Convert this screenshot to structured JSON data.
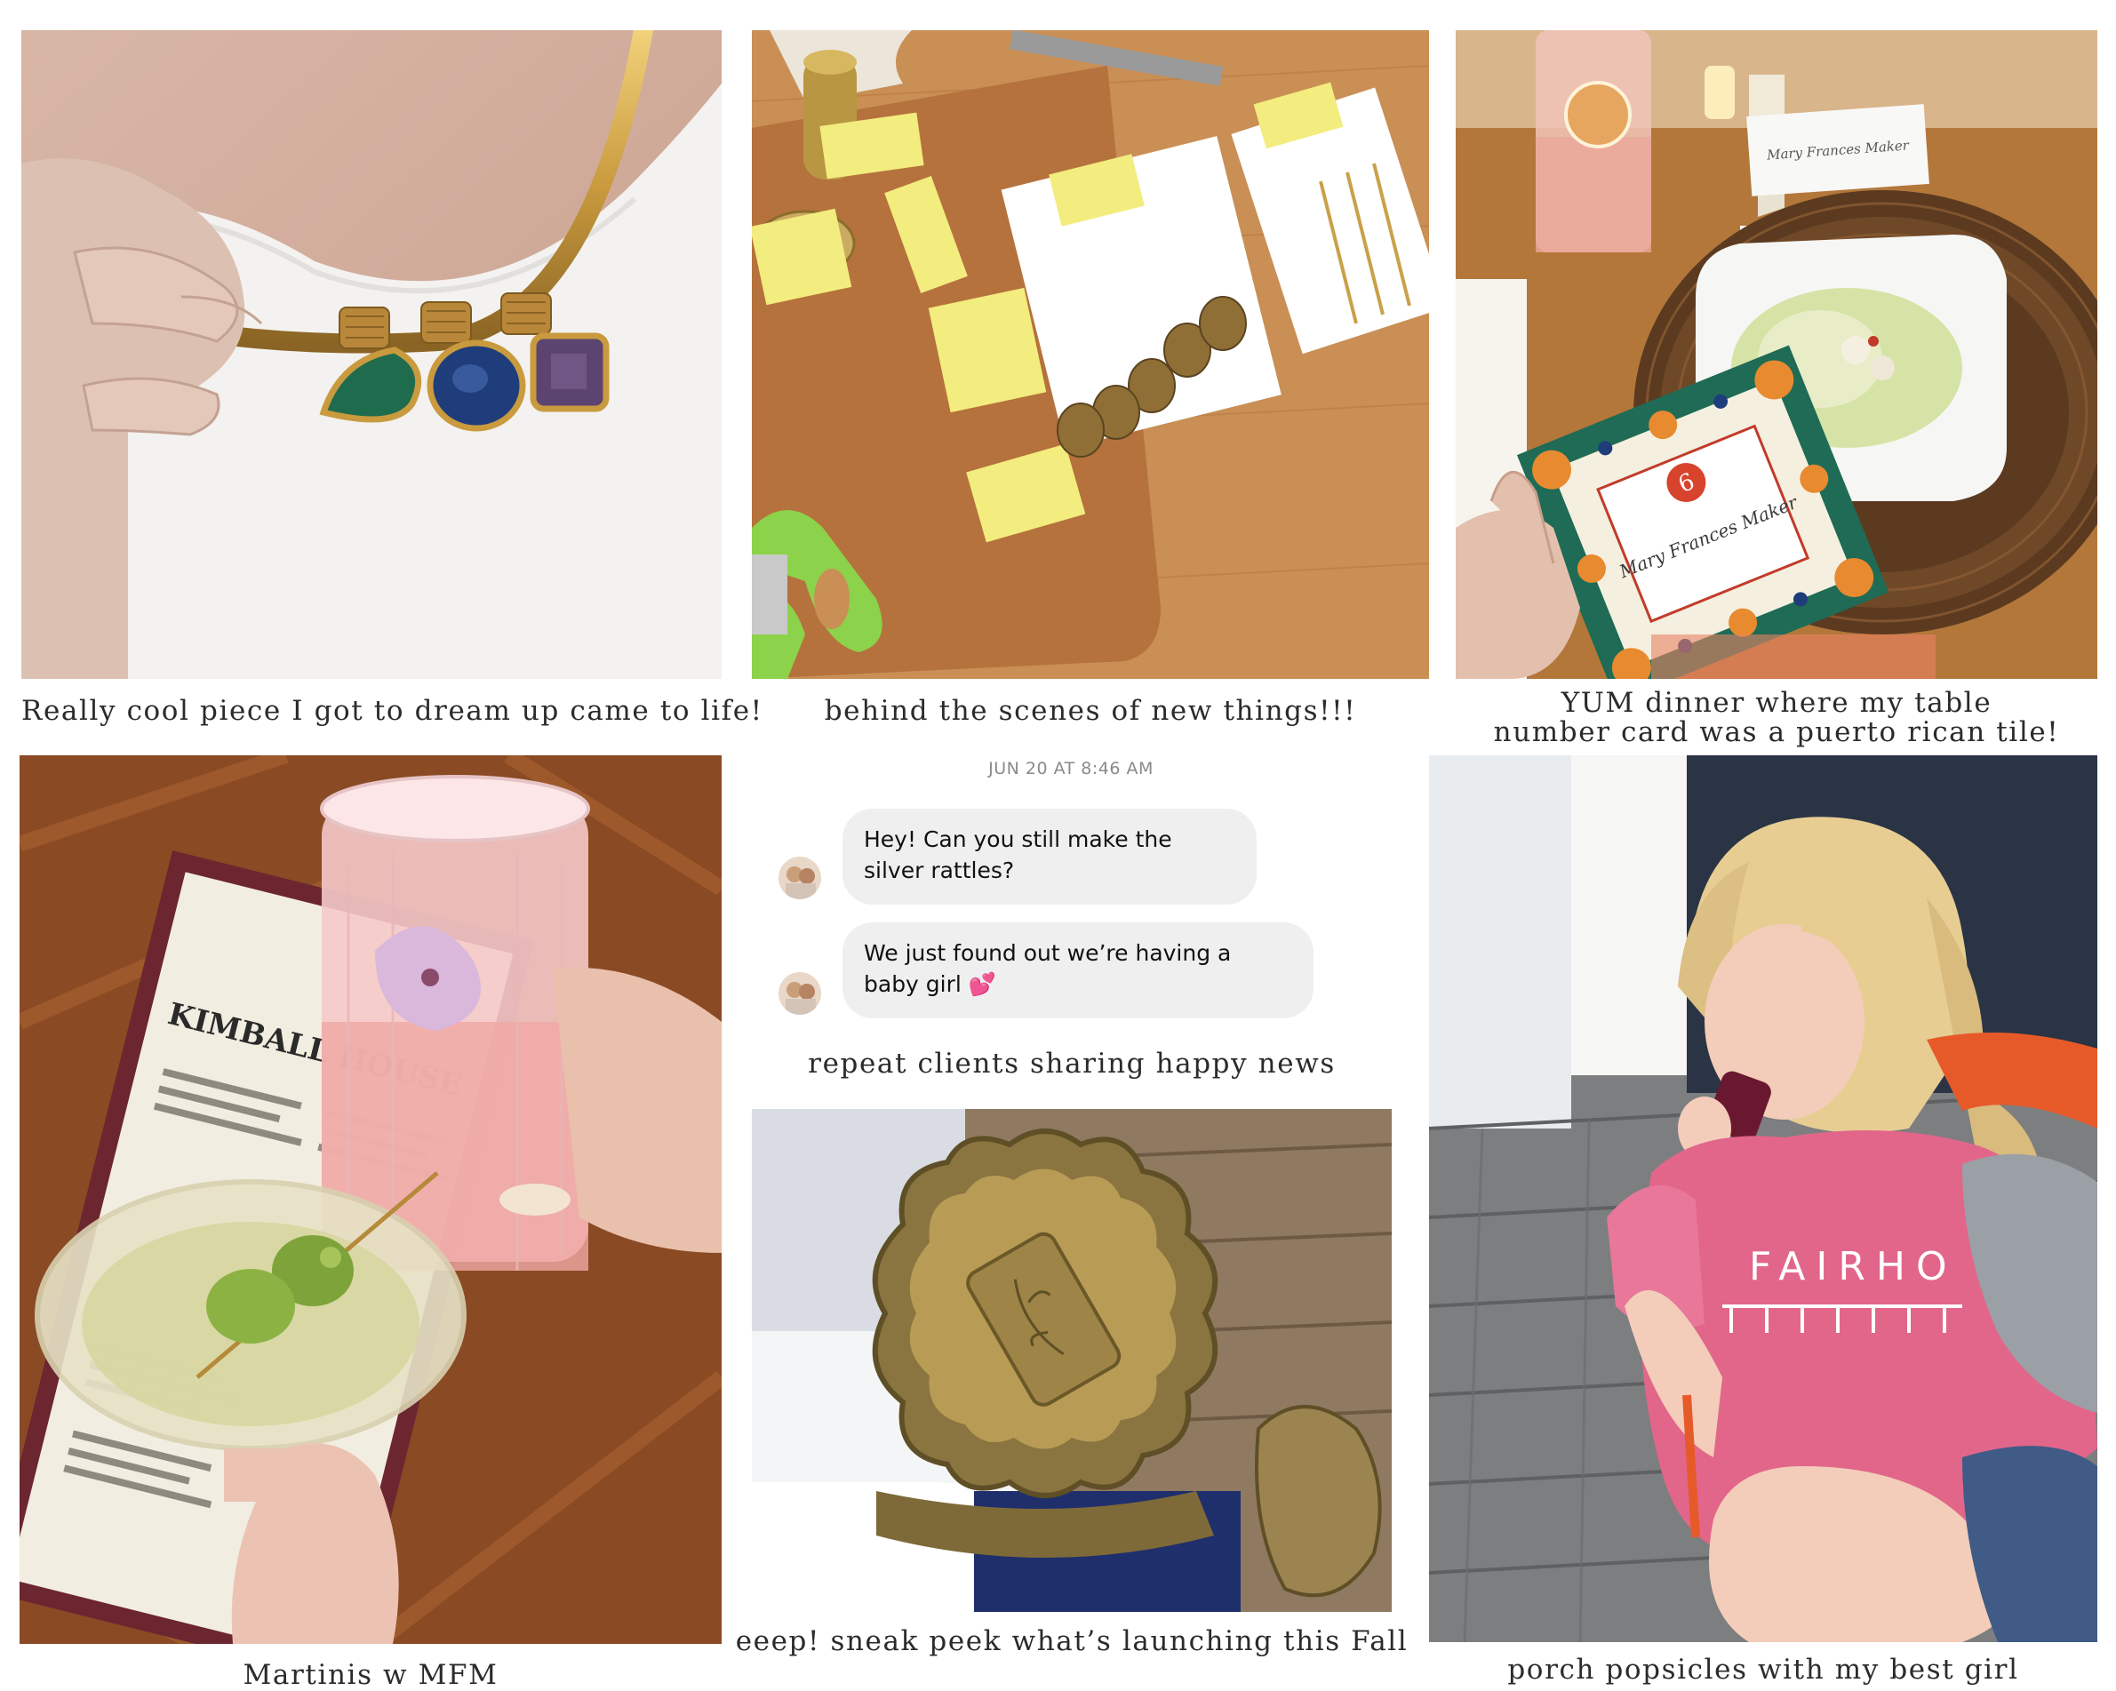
{
  "collage": {
    "photo1": {
      "caption": "Really cool piece I got to dream up came to life!"
    },
    "photo2": {
      "caption": "behind the scenes of new things!!!"
    },
    "photo3": {
      "caption_line1": "YUM dinner where my table",
      "caption_line2": "number card was a puerto rican tile!",
      "place_card_number": "6",
      "place_card_name": "Mary Frances Maker",
      "tent_card_name": "Mary Frances Maker"
    },
    "photo4": {
      "caption": "Martinis w MFM",
      "menu_title": "KIMBALL HOUSE"
    },
    "message_panel": {
      "timestamp": "JUN 20 AT 8:46 AM",
      "message1": "Hey! Can you still make the silver rattles?",
      "message2": "We just found out we’re having a baby girl 💕",
      "caption": "repeat clients sharing happy news"
    },
    "photo5": {
      "caption": "eeep! sneak peek what’s launching this Fall"
    },
    "photo6": {
      "caption": "porch popsicles with my best girl",
      "shirt_text": "FAIRHO"
    }
  },
  "colors": {
    "gold": "#c9a14a",
    "emerald": "#1f6b4e",
    "sapphire": "#1f3d7a",
    "amethyst": "#5c4470",
    "shirt_pink": "#e2668a",
    "leather": "#b5723d",
    "caption_text": "#2b2b2b"
  }
}
